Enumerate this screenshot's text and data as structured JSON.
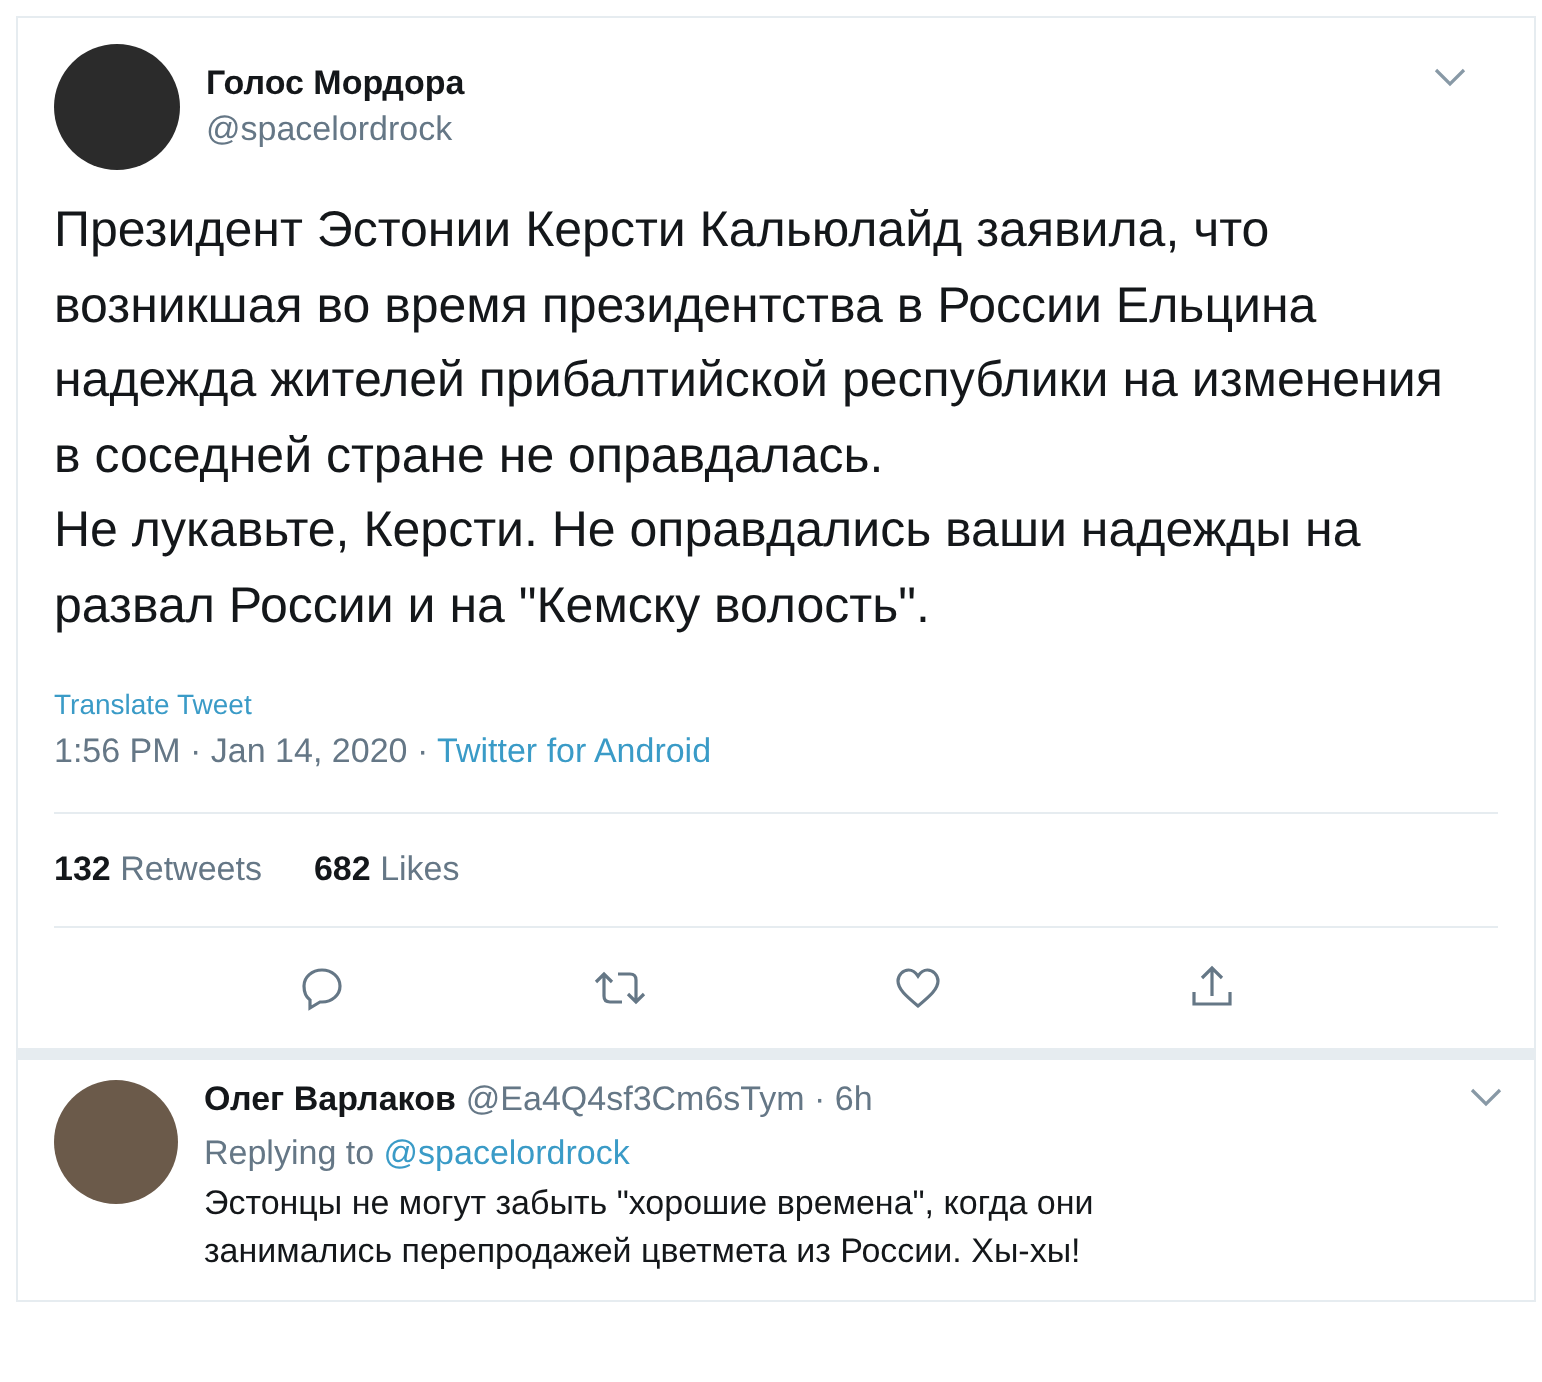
{
  "tweet": {
    "author": {
      "name": "Голос Мордора",
      "handle": "@spacelordrock"
    },
    "text": [
      "Президент Эстонии Керсти Кальюлайд заявила, что возникшая во время президентства в России Ельцина надежда жителей прибалтийской республики на изменения в соседней стране не оправдалась.",
      "Не лукавьте, Керсти. Не оправдались ваши надежды на развал России и на \"Кемску волость\"."
    ],
    "translate": "Translate Tweet",
    "time": "1:56 PM · Jan 14, 2020 · ",
    "source": "Twitter for Android",
    "stats": [
      {
        "count": "132",
        "label": "Retweets"
      },
      {
        "count": "682",
        "label": "Likes"
      }
    ]
  },
  "reply": {
    "author": {
      "name": "Олег Варлаков",
      "handle": "@Ea4Q4sf3Cm6sTym · 6h"
    },
    "replying_to": "Replying to ",
    "mention": "@spacelordrock",
    "text": "Эстонцы не могут забыть \"хорошие времена\", когда они занимались перепродажей цветмета из России. Хы-хы!"
  }
}
